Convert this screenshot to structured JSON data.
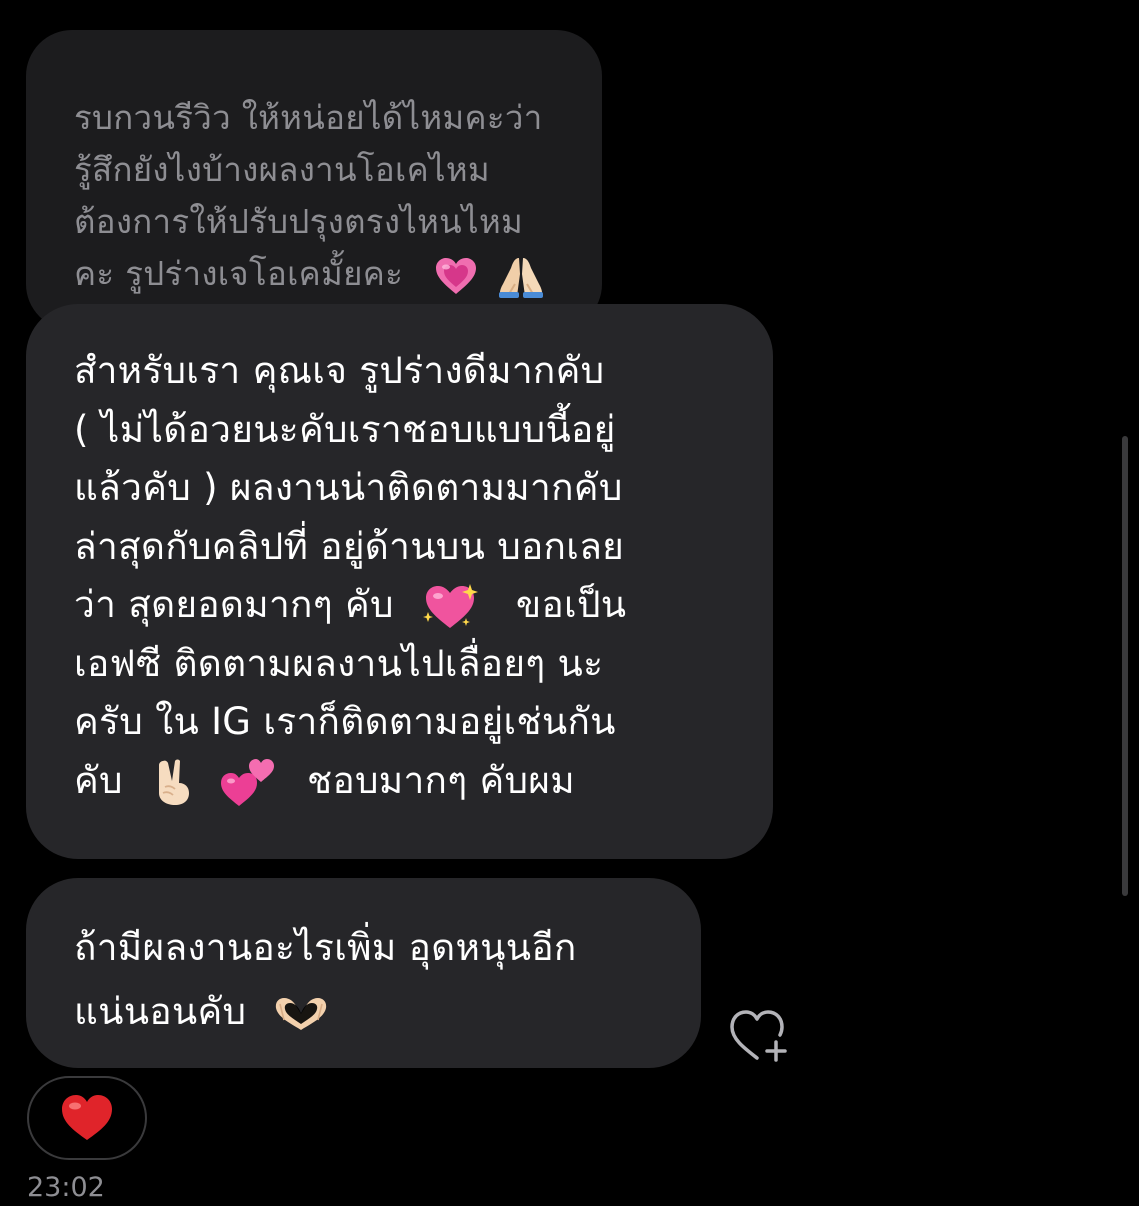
{
  "conversation": {
    "quoted_message": {
      "lines": [
        "รบกวนรีวิว ให้หน่อยได้ไหมคะว่า",
        "รู้สึกยังไงบ้างผลงานโอเคไหม",
        "ต้องการให้ปรับปรุงตรงไหนไหม",
        "คะ รูปร่างเจโอเคมั้ยคะ"
      ],
      "emoji_1": "growing-heart",
      "emoji_2": "folded-hands"
    },
    "main_message": {
      "lines": [
        "สำหรับเรา คุณเจ รูปร่างดีมากคับ",
        "( ไม่ได้อวยนะคับเราชอบแบบนี้อยู่",
        "แล้วคับ ) ผลงานน่าติดตามมากคับ",
        "ล่าสุดกับคลิปที่ อยู่ด้านบน บอกเลย",
        "ว่า สุดยอดมากๆ คับ",
        "ขอเป็น",
        "เอฟซี ติดตามผลงานไปเลื่อยๆ นะ",
        "ครับ ใน IG เราก็ติดตามอยู่เช่นกัน",
        "คับ",
        "ชอบมากๆ คับผม"
      ],
      "emoji_sparkling_heart": "sparkling-heart",
      "emoji_victory": "victory-hand",
      "emoji_two_hearts": "two-hearts"
    },
    "third_message": {
      "lines": [
        "ถ้ามีผลงานอะไรเพิ่ม อุดหนุนอีก",
        "แน่นอนคับ"
      ],
      "emoji": "heart-hands"
    },
    "reaction": {
      "emoji": "red-heart"
    },
    "timestamp": "23:02"
  },
  "colors": {
    "background": "#000000",
    "bubble": "#262629",
    "quoted_bubble": "#1c1c1e",
    "quoted_text": "#8e8e93",
    "text": "#ffffff",
    "heart_pink": "#ff4fa3",
    "heart_red": "#e0242a"
  }
}
